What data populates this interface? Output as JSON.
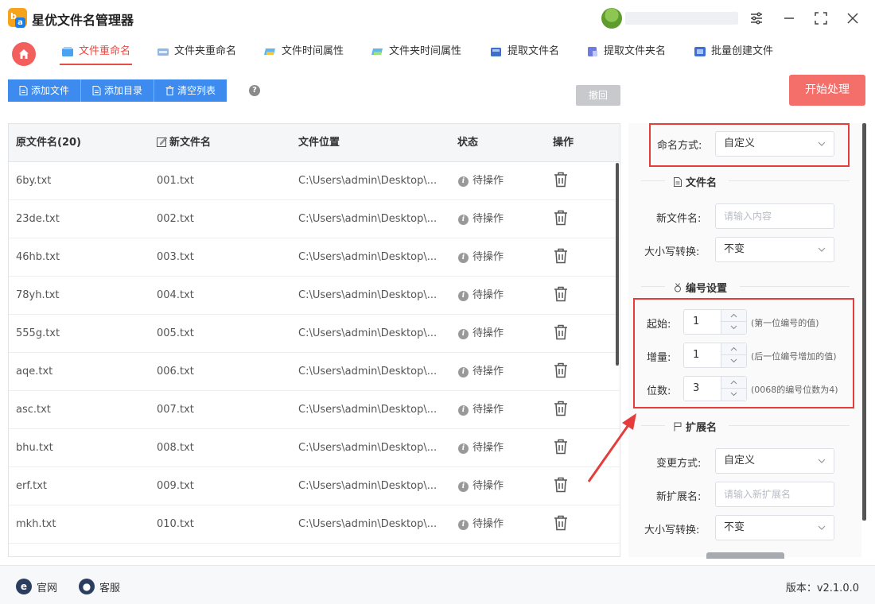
{
  "app": {
    "title": "星优文件名管理器"
  },
  "tabs": [
    {
      "label": "文件重命名",
      "active": true
    },
    {
      "label": "文件夹重命名"
    },
    {
      "label": "文件时间属性"
    },
    {
      "label": "文件夹时间属性"
    },
    {
      "label": "提取文件名"
    },
    {
      "label": "提取文件夹名"
    },
    {
      "label": "批量创建文件"
    }
  ],
  "toolbar": {
    "add_file": "添加文件",
    "add_dir": "添加目录",
    "clear_list": "清空列表",
    "help": "?",
    "undo": "撤回",
    "start": "开始处理"
  },
  "table": {
    "headers": {
      "orig": "原文件名(20)",
      "new": "新文件名",
      "location": "文件位置",
      "status": "状态",
      "action": "操作"
    },
    "rows": [
      {
        "orig": "6by.txt",
        "new": "001.txt",
        "location": "C:\\Users\\admin\\Desktop\\...",
        "status": "待操作"
      },
      {
        "orig": "23de.txt",
        "new": "002.txt",
        "location": "C:\\Users\\admin\\Desktop\\...",
        "status": "待操作"
      },
      {
        "orig": "46hb.txt",
        "new": "003.txt",
        "location": "C:\\Users\\admin\\Desktop\\...",
        "status": "待操作"
      },
      {
        "orig": "78yh.txt",
        "new": "004.txt",
        "location": "C:\\Users\\admin\\Desktop\\...",
        "status": "待操作"
      },
      {
        "orig": "555g.txt",
        "new": "005.txt",
        "location": "C:\\Users\\admin\\Desktop\\...",
        "status": "待操作"
      },
      {
        "orig": "aqe.txt",
        "new": "006.txt",
        "location": "C:\\Users\\admin\\Desktop\\...",
        "status": "待操作"
      },
      {
        "orig": "asc.txt",
        "new": "007.txt",
        "location": "C:\\Users\\admin\\Desktop\\...",
        "status": "待操作"
      },
      {
        "orig": "bhu.txt",
        "new": "008.txt",
        "location": "C:\\Users\\admin\\Desktop\\...",
        "status": "待操作"
      },
      {
        "orig": "erf.txt",
        "new": "009.txt",
        "location": "C:\\Users\\admin\\Desktop\\...",
        "status": "待操作"
      },
      {
        "orig": "mkh.txt",
        "new": "010.txt",
        "location": "C:\\Users\\admin\\Desktop\\...",
        "status": "待操作"
      }
    ]
  },
  "panel": {
    "naming_mode_label": "命名方式:",
    "naming_mode_value": "自定义",
    "filename_section": "文件名",
    "new_filename_label": "新文件名:",
    "new_filename_placeholder": "请输入内容",
    "case_label": "大小写转换:",
    "case_value": "不变",
    "numbering_section": "编号设置",
    "start_label": "起始:",
    "start_value": "1",
    "start_hint": "(第一位编号的值)",
    "increment_label": "增量:",
    "increment_value": "1",
    "increment_hint": "(后一位编号增加的值)",
    "digits_label": "位数:",
    "digits_value": "3",
    "digits_hint": "(0068的编号位数为4)",
    "ext_section": "扩展名",
    "ext_mode_label": "变更方式:",
    "ext_mode_value": "自定义",
    "new_ext_label": "新扩展名:",
    "new_ext_placeholder": "请输入新扩展名",
    "ext_case_label": "大小写转换:",
    "ext_case_value": "不变"
  },
  "footer": {
    "website": "官网",
    "support": "客服",
    "version": "版本：v2.1.0.0"
  },
  "colors": {
    "accent": "#e94b47",
    "primary": "#3d8bee",
    "start": "#f46e6a",
    "highlight": "#e53c3c"
  }
}
